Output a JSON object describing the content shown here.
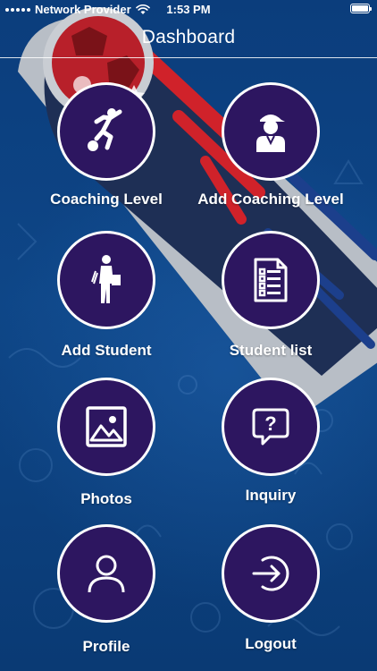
{
  "status_bar": {
    "carrier": "Network Provider",
    "time": "1:53 PM"
  },
  "nav": {
    "title": "Dashboard"
  },
  "menu": [
    {
      "label": "Coaching Level",
      "icon": "soccer-player-icon"
    },
    {
      "label": "Add Coaching Level",
      "icon": "coach-icon"
    },
    {
      "label": "Add Student",
      "icon": "student-icon"
    },
    {
      "label": "Student list",
      "icon": "checklist-icon"
    },
    {
      "label": "Photos",
      "icon": "image-icon"
    },
    {
      "label": "Inquiry",
      "icon": "question-bubble-icon"
    },
    {
      "label": "Profile",
      "icon": "user-icon"
    },
    {
      "label": "Logout",
      "icon": "logout-icon"
    }
  ],
  "colors": {
    "background": "#0e4687",
    "tile_fill": "#2d1660",
    "tile_border": "#ffffff",
    "comet_trail": "#b8bec6",
    "accent_red": "#d0222a"
  }
}
